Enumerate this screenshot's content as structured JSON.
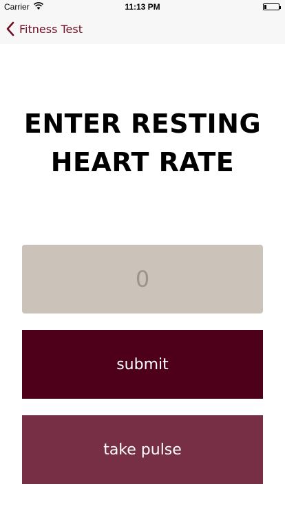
{
  "status_bar": {
    "carrier": "Carrier",
    "time": "11:13 PM",
    "wifi_icon": "wifi-icon",
    "battery_icon": "battery-icon"
  },
  "nav": {
    "back_label": "Fitness Test",
    "back_icon": "chevron-left-icon"
  },
  "heading": {
    "line1": "ENTER RESTING",
    "line2": "HEART RATE"
  },
  "heart_rate_input": {
    "value": "",
    "placeholder": "0"
  },
  "buttons": {
    "submit_label": "submit",
    "pulse_label": "take pulse"
  },
  "colors": {
    "accent": "#6e0f22",
    "input_bg": "#cbc3b9",
    "submit_bg": "#4e001a",
    "pulse_bg": "#772f46"
  }
}
